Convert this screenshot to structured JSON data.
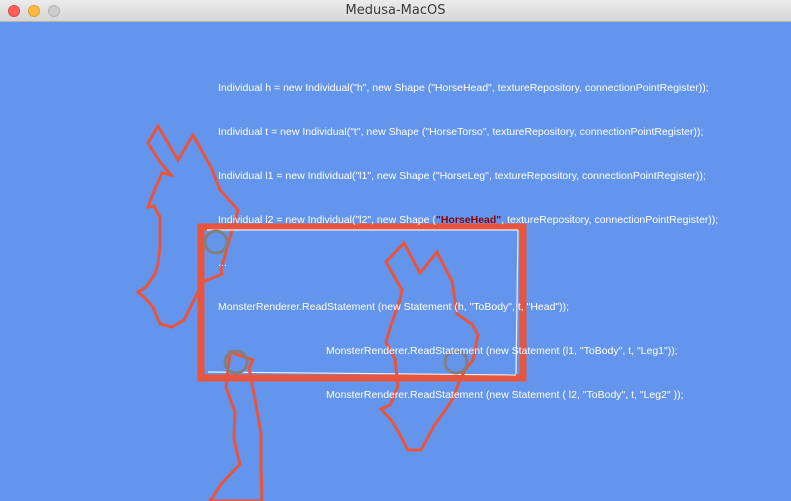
{
  "window": {
    "title": "Medusa-MacOS"
  },
  "code": {
    "line1": "Individual h = new Individual(\"h\", new Shape (\"HorseHead\", textureRepository, connectionPointRegister));",
    "line2": "Individual t = new Individual(\"t\", new Shape (\"HorseTorso\", textureRepository, connectionPointRegister));",
    "line3": "Individual l1 = new Individual(\"l1\", new Shape (\"HorseLeg\", textureRepository, connectionPointRegister));",
    "line4_before": "Individual l2 = new Individual(\"l2\", new Shape (",
    "line4_highlight": "\"HorseHead\"",
    "line4_after": ", textureRepository, connectionPointRegister));",
    "line5": "...",
    "line6": "MonsterRenderer.ReadStatement (new Statement (h, \"ToBody\", t, \"Head\"));",
    "line7": "MonsterRenderer.ReadStatement (new Statement (l1, \"ToBody\", t, \"Leg1\"));",
    "line8": "MonsterRenderer.ReadStatement (new Statement ( l2, \"ToBody\", t, \"Leg2\" ));"
  },
  "colors": {
    "background": "#6495ed",
    "shape_stroke": "#e8553e",
    "connector_stroke": "#808080",
    "highlight_text": "#8b0000"
  },
  "icons": {
    "close": "red-circle",
    "minimize": "yellow-circle",
    "maximize": "gray-circle"
  }
}
